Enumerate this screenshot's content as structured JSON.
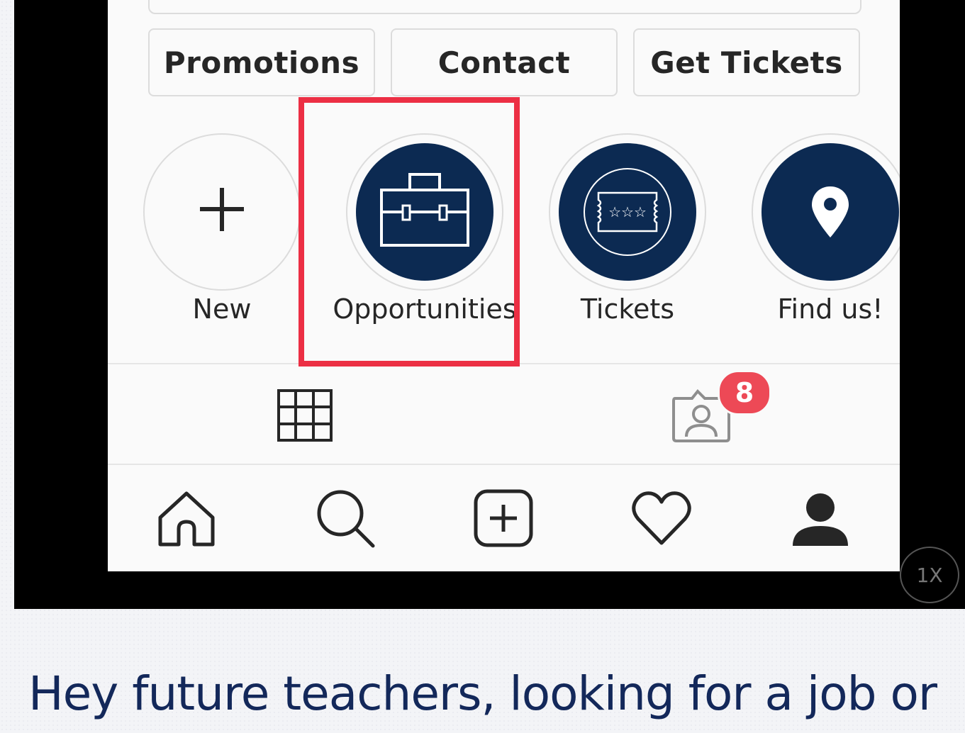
{
  "profile": {
    "action_buttons": [
      "Promotions",
      "Contact",
      "Get Tickets"
    ],
    "highlights": [
      {
        "label": "New",
        "icon": "plus-icon"
      },
      {
        "label": "Opportunities",
        "icon": "briefcase-icon"
      },
      {
        "label": "Tickets",
        "icon": "ticket-icon"
      },
      {
        "label": "Find us!",
        "icon": "location-pin-icon"
      }
    ],
    "tabs": {
      "grid_icon": "grid-icon",
      "tagged_icon": "tagged-photos-icon",
      "tagged_badge": "8"
    }
  },
  "bottom_nav": [
    "home-icon",
    "search-icon",
    "add-post-icon",
    "heart-icon",
    "profile-icon"
  ],
  "player": {
    "speed": "1X"
  },
  "caption": "Hey future teachers, looking for a job or",
  "colors": {
    "highlight_disc": "#0c2a52",
    "callout_box": "#ec2f44",
    "badge": "#ed4956",
    "caption_text": "#13285a"
  }
}
